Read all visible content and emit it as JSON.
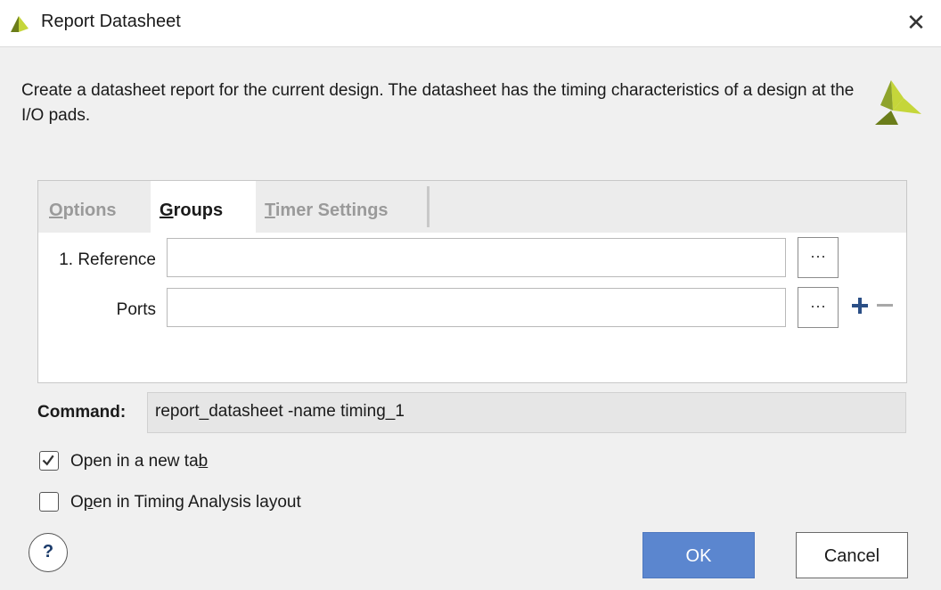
{
  "window": {
    "title": "Report Datasheet",
    "close_glyph": "✕"
  },
  "description": "Create a datasheet report for the current design. The datasheet has the timing characteristics of a design at the I/O pads.",
  "tabs": [
    {
      "label": "Options",
      "mnemonic": "O",
      "active": false
    },
    {
      "label": "Groups",
      "mnemonic": "G",
      "active": true
    },
    {
      "label": "Timer Settings",
      "mnemonic": "T",
      "active": false
    }
  ],
  "groups": {
    "reference_label": "1. Reference",
    "reference_value": "",
    "ports_label": "Ports",
    "ports_value": "",
    "browse_glyph": "···"
  },
  "command": {
    "label": "Command:",
    "value": "report_datasheet -name timing_1"
  },
  "options": [
    {
      "label": "Open in a new tab",
      "checked": true
    },
    {
      "label": "Open in Timing Analysis layout",
      "checked": false
    }
  ],
  "buttons": {
    "help": "?",
    "ok": "OK",
    "cancel": "Cancel"
  },
  "colors": {
    "accent": "#5b86cf",
    "logo_dark": "#6b7d1a",
    "logo_light": "#c5d63a"
  },
  "icons": [
    "app-logo-icon",
    "close-icon",
    "vivado-logo-icon",
    "browse-icon",
    "plus-icon",
    "minus-icon",
    "check-icon",
    "help-icon"
  ]
}
